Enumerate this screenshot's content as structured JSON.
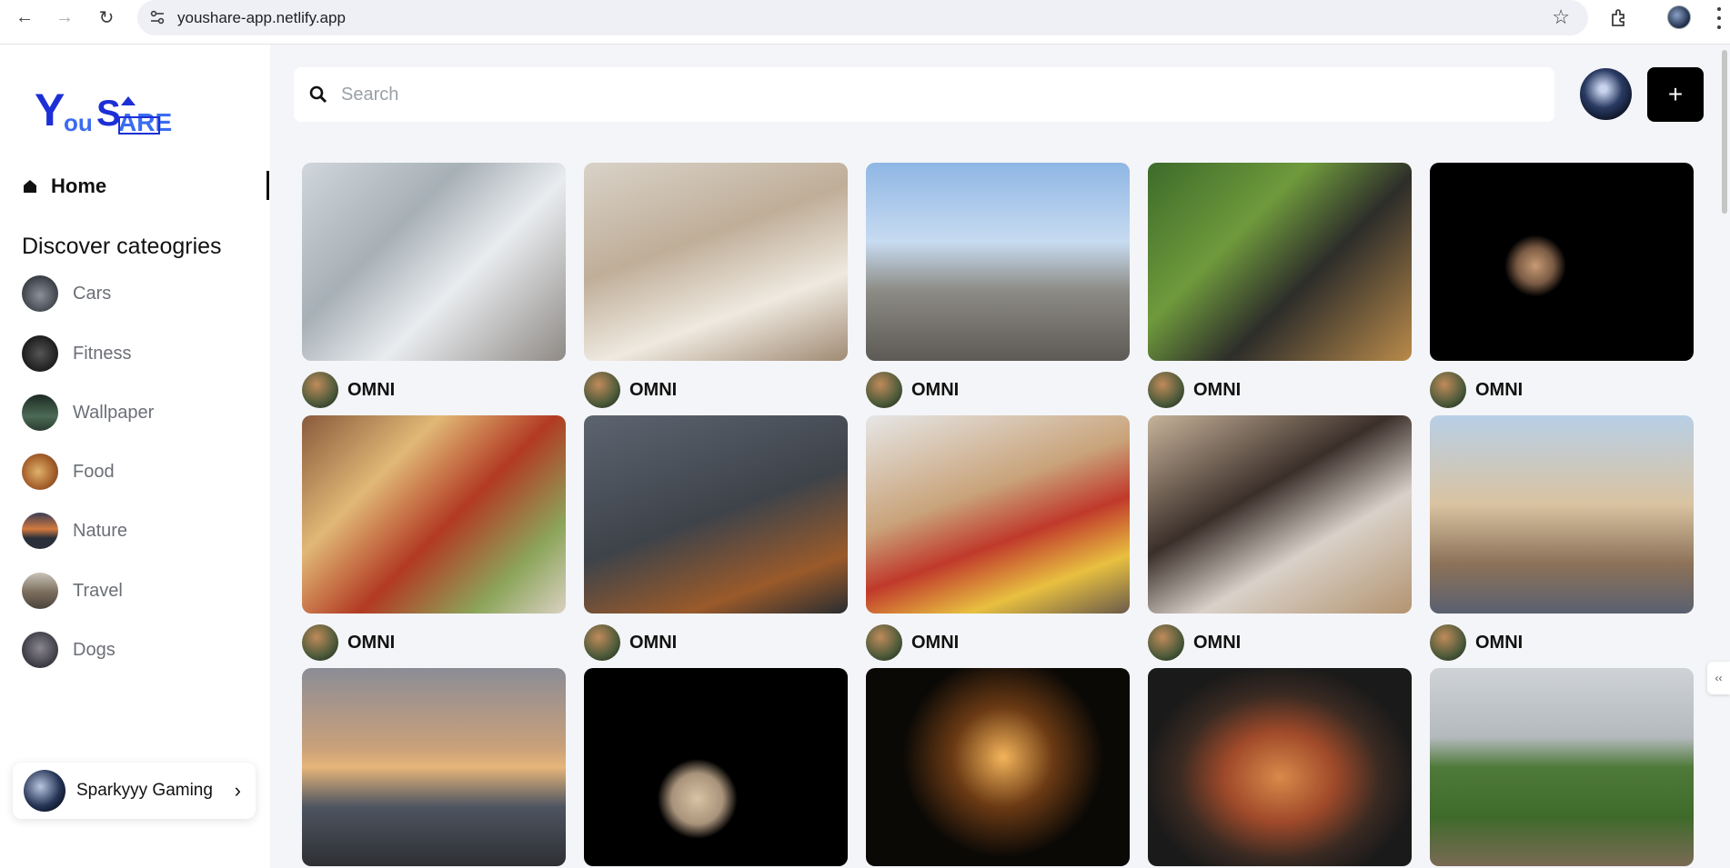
{
  "browser": {
    "url": "youshare-app.netlify.app"
  },
  "sidebar": {
    "logo_text": "YouShare",
    "home_label": "Home",
    "discover_heading": "Discover cateogries",
    "categories": [
      {
        "label": "Cars",
        "color": "#3a3f48"
      },
      {
        "label": "Fitness",
        "color": "#2b2b2b"
      },
      {
        "label": "Wallpaper",
        "color": "#2f4a3a"
      },
      {
        "label": "Food",
        "color": "#b67a3c"
      },
      {
        "label": "Nature",
        "color": "#b96a3a"
      },
      {
        "label": "Travel",
        "color": "#6e6458"
      },
      {
        "label": "Dogs",
        "color": "#4a4a52"
      }
    ],
    "user": {
      "name": "Sparkyyy Gaming"
    }
  },
  "header": {
    "search_placeholder": "Search",
    "add_label": "+"
  },
  "pins": [
    {
      "author": "OMNI",
      "bg": "linear-gradient(135deg,#cfd6dc 0%,#a7b0b6 35%,#e9ecef 60%,#8f8a86 100%)"
    },
    {
      "author": "OMNI",
      "bg": "linear-gradient(160deg,#d9d2c8 0%,#bfae98 40%,#efe9e0 70%,#a08b74 100%)"
    },
    {
      "author": "OMNI",
      "bg": "linear-gradient(180deg,#8fb6e4 0%,#c7dbf1 40%,#8c8a84 65%,#5d5a55 100%)"
    },
    {
      "author": "OMNI",
      "bg": "linear-gradient(135deg,#3d6b2a 0%,#6f9a3c 35%,#2d2d2a 60%,#b98a4a 100%)"
    },
    {
      "author": "OMNI",
      "bg": "radial-gradient(circle at 40% 52%,#c89b74 0px,#7a5a44 20px,#000 34px)"
    },
    {
      "author": "OMNI",
      "bg": "linear-gradient(135deg,#8a5a3c 0%,#e1b876 30%,#b23a22 55%,#8ca55a 80%,#d9d0c2 100%)"
    },
    {
      "author": "OMNI",
      "bg": "linear-gradient(160deg,#5c6470 0%,#3e434a 50%,#9a5a2a 80%,#2a2d31 100%)"
    },
    {
      "author": "OMNI",
      "bg": "linear-gradient(160deg,#e6e6e6 0%,#c9a37a 40%,#c0392b 60%,#e8c040 80%,#6a5a4a 100%)"
    },
    {
      "author": "OMNI",
      "bg": "linear-gradient(150deg,#c7b39a 0%,#3b2f2a 40%,#d9d1c9 65%,#b39470 100%)"
    },
    {
      "author": "OMNI",
      "bg": "linear-gradient(180deg,#b8cfe6 0%,#d9c3a1 45%,#8c7258 75%,#5a6070 100%)"
    },
    {
      "author": "",
      "bg": "linear-gradient(180deg,#8b8d96 0%,#c9a07a 40%,#e6b57a 50%,#4e5561 70%,#2e2f33 100%)"
    },
    {
      "author": "",
      "bg": "radial-gradient(circle at 43% 66%,#d9c3a4 0px,#a8927a 28px,#000 44px)"
    },
    {
      "author": "",
      "bg": "radial-gradient(circle at 52% 45%,#f3b45a 0px,#6b3a14 55px,#0b0906 110px)"
    },
    {
      "author": "",
      "bg": "radial-gradient(ellipse at 50% 55%,#d88a4a 0px,#a04a2a 60px,#3a2a22 110px,#1a1a1a 150px)"
    },
    {
      "author": "",
      "bg": "linear-gradient(180deg,#cfd3d6 0%,#b4b9bd 35%,#4f7a3a 50%,#3e6a2a 75%,#7a6a55 100%)"
    }
  ]
}
